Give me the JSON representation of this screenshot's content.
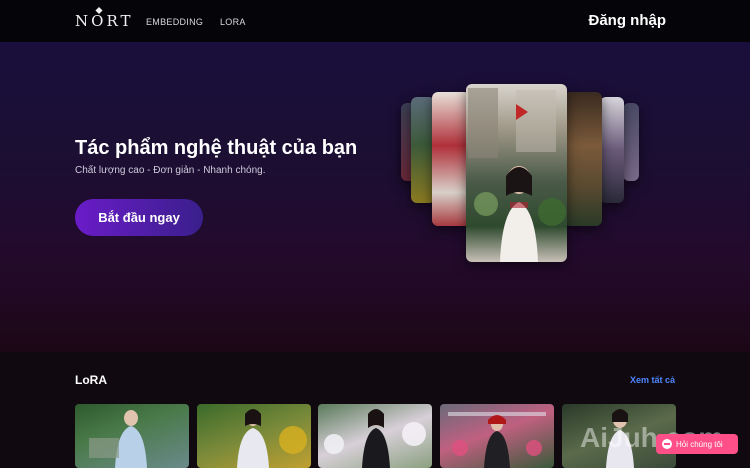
{
  "header": {
    "logo_text": "NORT",
    "nav": [
      {
        "label": "EMBEDDING"
      },
      {
        "label": "LORA"
      }
    ],
    "login_label": "Đăng nhập"
  },
  "hero": {
    "title": "Tác phẩm nghệ thuật của bạn",
    "subtitle": "Chất lượng cao - Đơn giản - Nhanh chóng.",
    "cta_label": "Bắt đầu ngay"
  },
  "lora": {
    "title": "LoRA",
    "see_all_label": "Xem tất cả"
  },
  "overlay": {
    "watermark": "AiJuh.com",
    "chat_label": "Hỏi chúng tôi"
  },
  "colors": {
    "accent_purple": "#6a1cc8",
    "link_blue": "#4e86ff",
    "chat_pink": "#ff4f88"
  }
}
